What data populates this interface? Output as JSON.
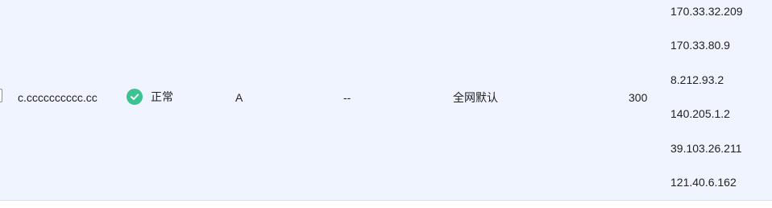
{
  "row": {
    "domain": "c.cccccccccc.cc",
    "status": {
      "label": "正常",
      "color": "#3cc38f",
      "icon": "check-circle-icon"
    },
    "type": "A",
    "host": "--",
    "line": "全网默认",
    "ttl": "300",
    "values": [
      "170.33.32.209",
      "170.33.80.9",
      "8.212.93.2",
      "140.205.1.2",
      "39.103.26.211",
      "121.40.6.162"
    ]
  },
  "colors": {
    "row_background": "#eff4fe",
    "status_green": "#3cc38f"
  }
}
